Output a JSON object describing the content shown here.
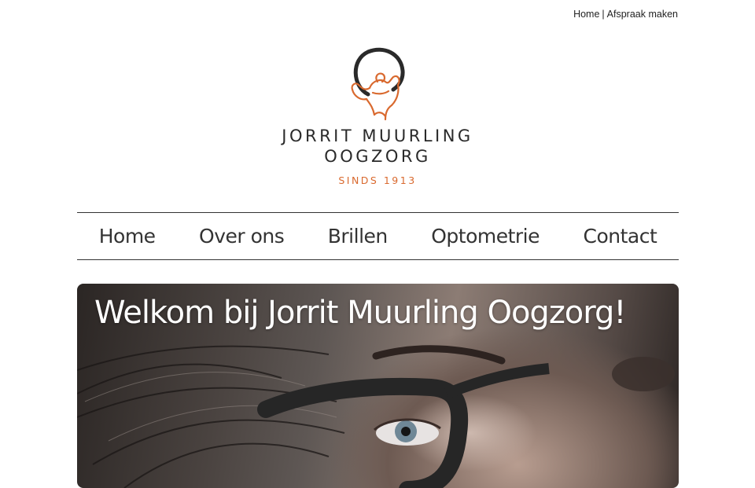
{
  "topbar": {
    "home_label": "Home",
    "separator": "|",
    "appointment_label": "Afspraak maken"
  },
  "logo": {
    "line1": "JORRIT MUURLING",
    "line2": "OOGZORG",
    "since": "SINDS 1913",
    "accent_color": "#d9692e",
    "icon": "atlas-figure-holding-lens-icon"
  },
  "nav": {
    "items": [
      {
        "label": "Home"
      },
      {
        "label": "Over ons"
      },
      {
        "label": "Brillen"
      },
      {
        "label": "Optometrie"
      },
      {
        "label": "Contact"
      }
    ]
  },
  "hero": {
    "title": "Welkom bij Jorrit Muurling Oogzorg!",
    "image": "woman-with-dark-glasses-photo"
  }
}
